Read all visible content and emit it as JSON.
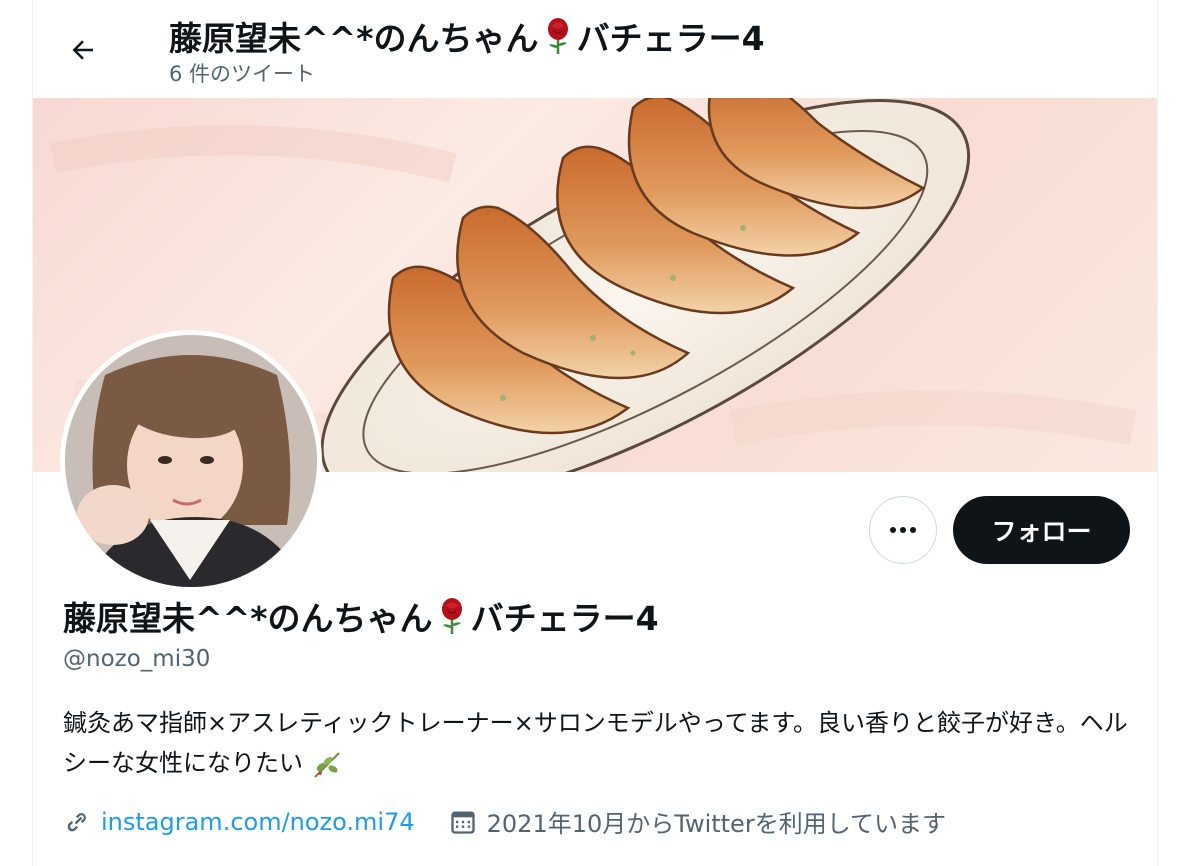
{
  "header": {
    "title": "藤原望未^^*のんちゃん",
    "title_suffix": "バチェラー4",
    "subtitle": "6 件のツイート",
    "back_icon": "arrow-left-icon"
  },
  "profile": {
    "display_name": "藤原望未^^*のんちゃん",
    "display_name_suffix": "バチェラー4",
    "handle": "@nozo_mi30",
    "bio": "鍼灸あマ指師×アスレティックトレーナー×サロンモデルやってます。良い香りと餃子が好き。ヘルシーな女性になりたい",
    "website": "instagram.com/nozo.mi74",
    "joined": "2021年10月からTwitterを利用しています"
  },
  "actions": {
    "follow_label": "フォロー",
    "more_icon": "more-dots-icon"
  },
  "colors": {
    "accent": "#1d9bf0",
    "text_primary": "#0f1419",
    "text_secondary": "#536471",
    "follow_bg": "#0f1419"
  }
}
